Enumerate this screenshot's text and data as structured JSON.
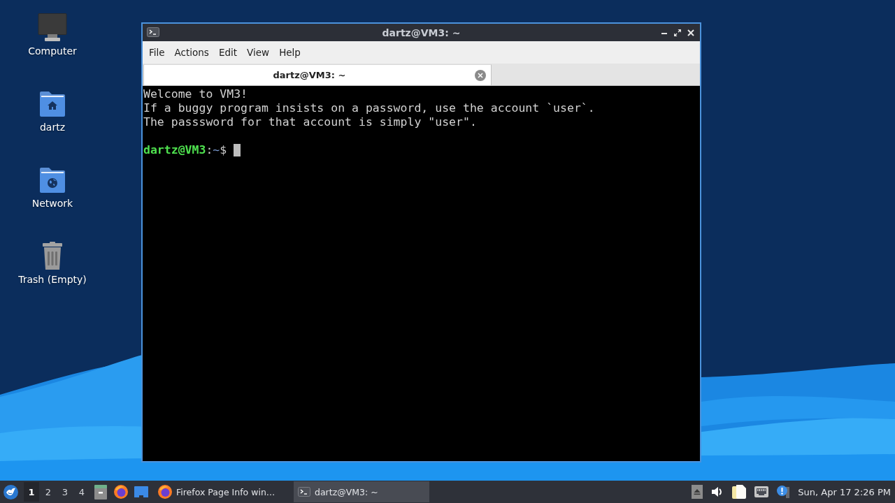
{
  "desktop_icons": [
    {
      "kind": "computer",
      "label": "Computer"
    },
    {
      "kind": "home",
      "label": "dartz"
    },
    {
      "kind": "network",
      "label": "Network"
    },
    {
      "kind": "trash",
      "label": "Trash (Empty)"
    }
  ],
  "terminal_window": {
    "title": "dartz@VM3: ~",
    "menu": [
      "File",
      "Actions",
      "Edit",
      "View",
      "Help"
    ],
    "tabs": [
      {
        "label": "dartz@VM3: ~",
        "selected": true
      }
    ],
    "output_lines": [
      "Welcome to VM3!",
      "If a buggy program insists on a password, use the account `user`.",
      "The passsword for that account is simply \"user\"."
    ],
    "prompt": {
      "user_host": "dartz@VM3",
      "separator": ":",
      "path": "~",
      "symbol": "$"
    }
  },
  "taskbar": {
    "workspaces": [
      {
        "label": "1",
        "selected": true
      },
      {
        "label": "2",
        "selected": false
      },
      {
        "label": "3",
        "selected": false
      },
      {
        "label": "4",
        "selected": false
      }
    ],
    "launchers": [
      {
        "kind": "files"
      },
      {
        "kind": "browser"
      },
      {
        "kind": "desktop"
      }
    ],
    "tasks": [
      {
        "kind": "browser",
        "label": "Firefox Page Info win…",
        "selected": false
      },
      {
        "kind": "terminal",
        "label": "dartz@VM3: ~",
        "selected": true
      }
    ],
    "tray": [
      {
        "kind": "eject"
      },
      {
        "kind": "volume"
      },
      {
        "kind": "notes"
      },
      {
        "kind": "network"
      },
      {
        "kind": "notification"
      }
    ],
    "clock": "Sun, Apr 17 2:26 PM"
  }
}
